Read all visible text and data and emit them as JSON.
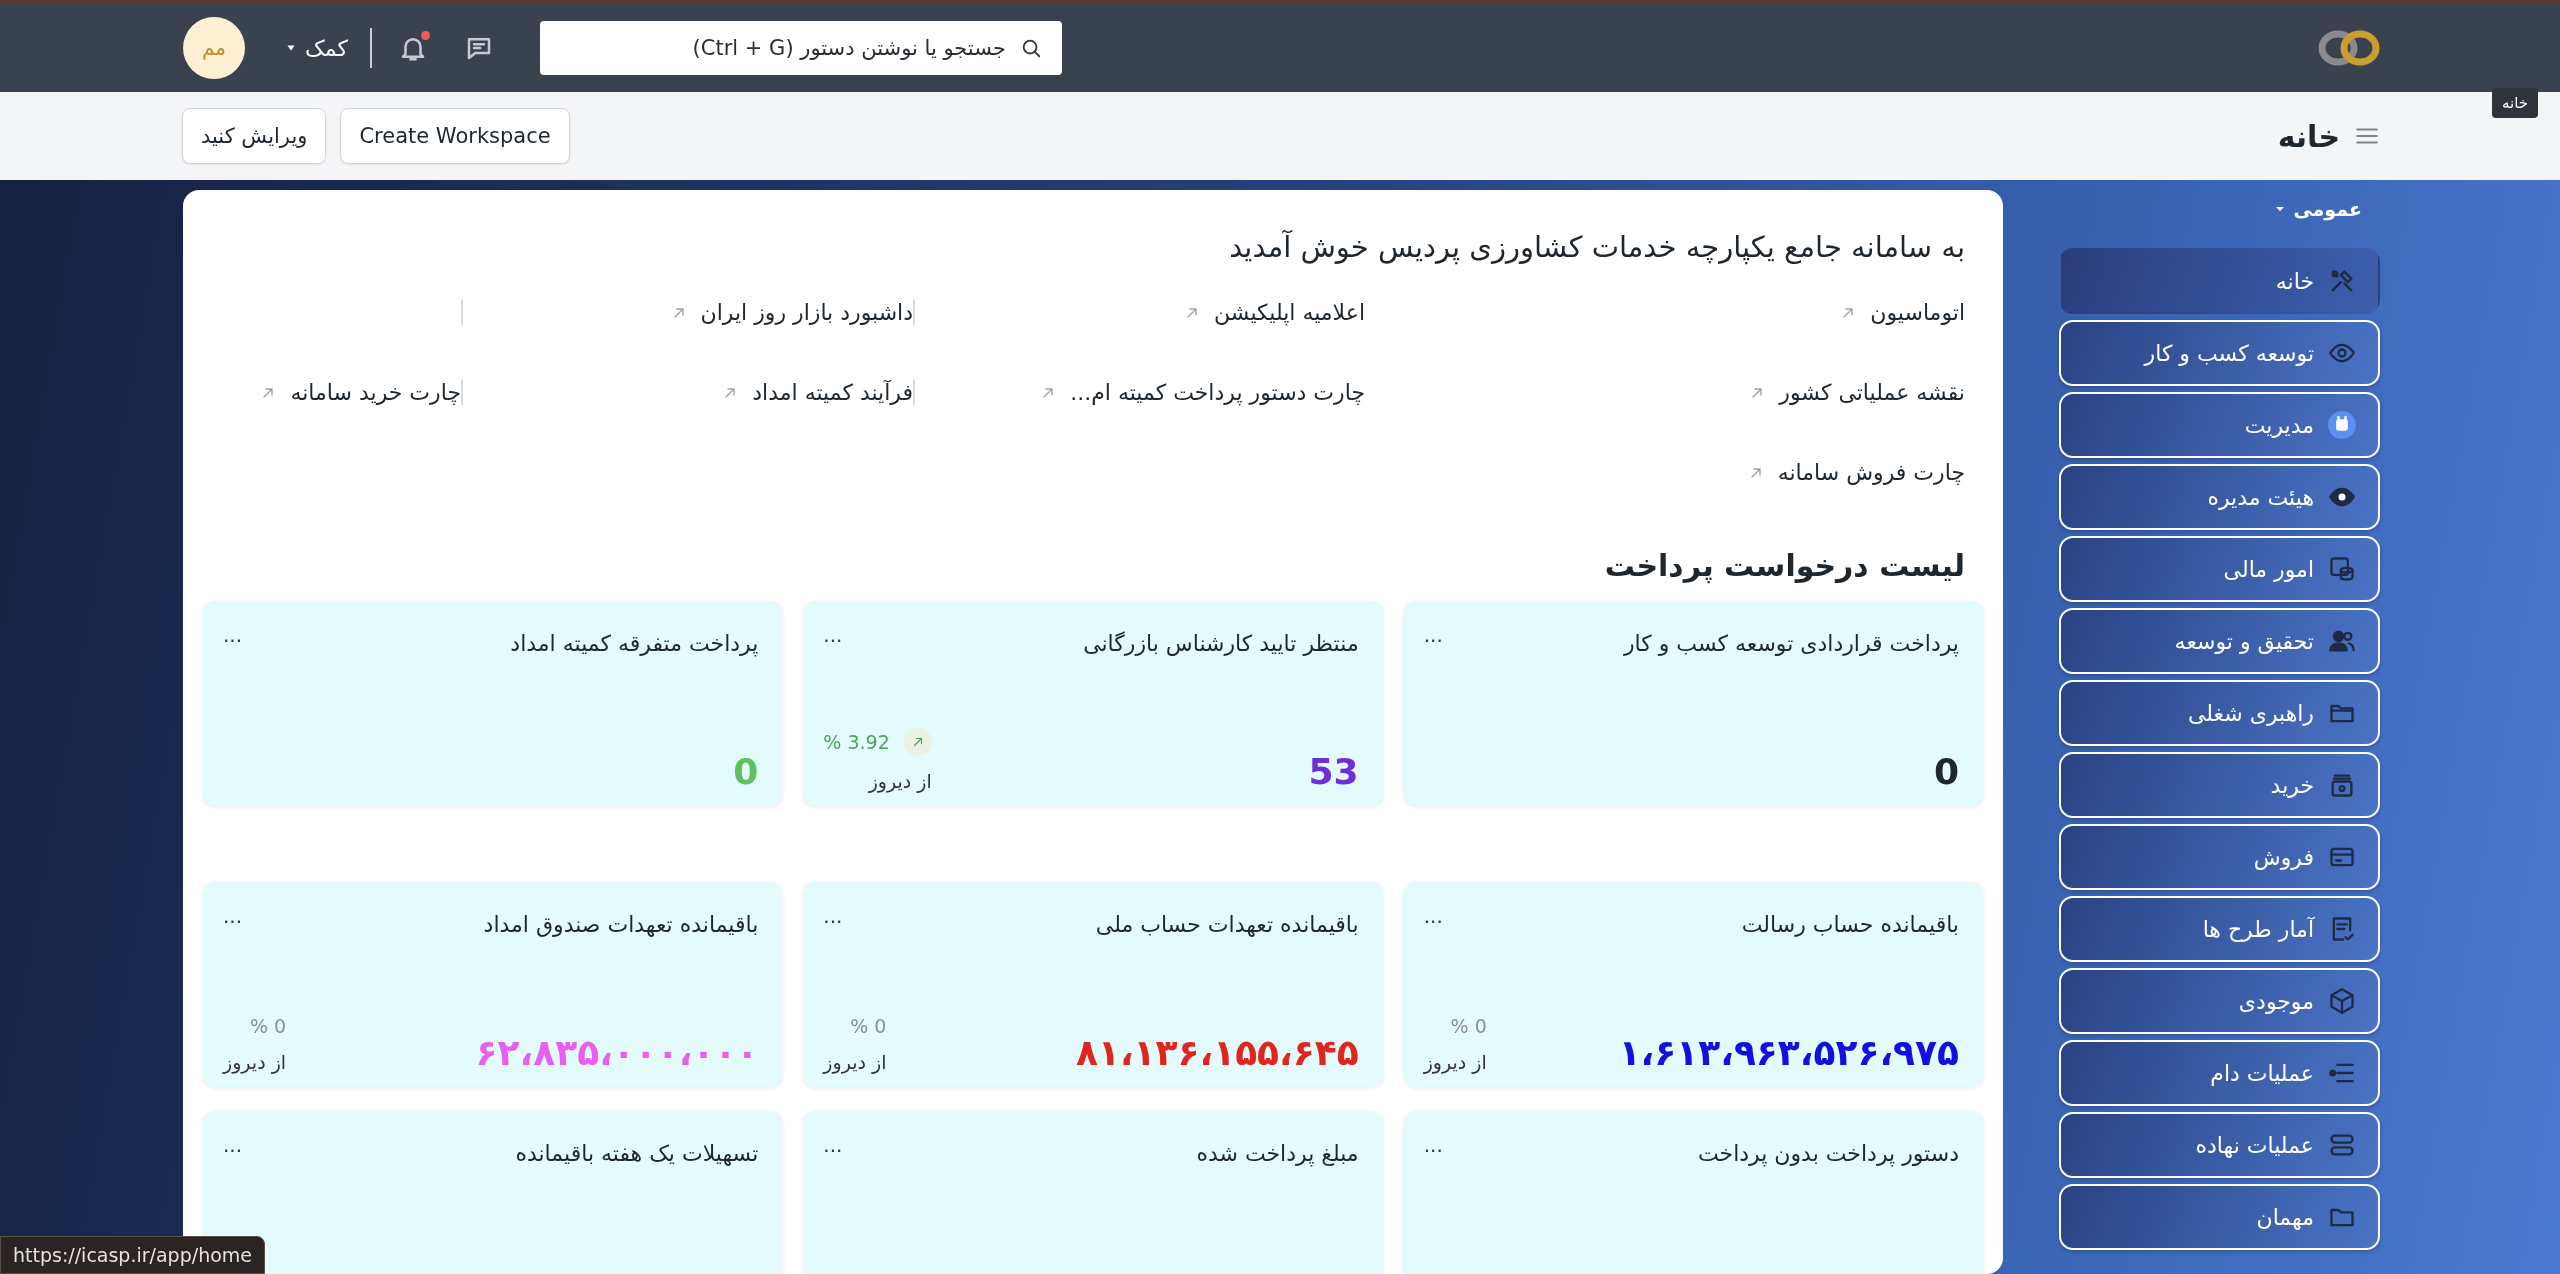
{
  "navbar": {
    "search": {
      "placeholder": "جستجو یا نوشتن دستور (Ctrl + G)"
    },
    "notifications": {
      "unread": true
    },
    "help": {
      "label": "کمک"
    },
    "avatar": {
      "initials": "مم"
    }
  },
  "tooltip": {
    "text": "خانه"
  },
  "page_header": {
    "title": "خانه",
    "buttons": [
      {
        "label": "Create Workspace"
      },
      {
        "label": "ویرایش کنید"
      }
    ]
  },
  "sidebar": {
    "section": {
      "label": "عمومی",
      "expanded": true
    },
    "items": [
      {
        "label": "خانه",
        "selected": true
      },
      {
        "label": "توسعه کسب و کار",
        "selected": false
      },
      {
        "label": "مدیریت",
        "selected": false
      },
      {
        "label": "هیئت مدیره",
        "selected": false
      },
      {
        "label": "امور مالی",
        "selected": false
      },
      {
        "label": "تحقیق و توسعه",
        "selected": false
      },
      {
        "label": "راهبری شغلی",
        "selected": false
      },
      {
        "label": "خرید",
        "selected": false
      },
      {
        "label": "فروش",
        "selected": false
      },
      {
        "label": "آمار طرح ها",
        "selected": false
      },
      {
        "label": "موجودی",
        "selected": false
      },
      {
        "label": "عملیات دام",
        "selected": false
      },
      {
        "label": "عملیات نهاده",
        "selected": false
      },
      {
        "label": "مهمان",
        "selected": false
      }
    ]
  },
  "welcome": {
    "title": "به سامانه جامع یکپارچه خدمات کشاورزی پردیس خوش آمدید",
    "shortcut_rows": [
      [
        "اتوماسیون",
        "اعلامیه اپلیکیشن",
        "داشبورد بازار روز ایران"
      ],
      [
        "نقشه عملیاتی کشور",
        "چارت دستور پرداخت کمیته ام...",
        "فرآیند کمیته امداد",
        "چارت خرید سامانه"
      ],
      [
        "چارت فروش سامانه"
      ]
    ]
  },
  "sections": [
    {
      "title": "لیست درخواست پرداخت",
      "cards": [
        {
          "title": "پرداخت قراردادی توسعه کسب و کار",
          "menu": "...",
          "value": "0",
          "color": "#1f272e"
        },
        {
          "title": "منتظر تایید کارشناس بازرگانی",
          "menu": "...",
          "value": "53",
          "color": "#6d2fd6",
          "change": "3.92 %",
          "rising": true,
          "since": "از دیروز"
        },
        {
          "title": "پرداخت متفرقه کمیته امداد",
          "menu": "...",
          "value": "0",
          "color": "#5cc35c"
        }
      ]
    },
    {
      "cards": [
        {
          "title": "باقیمانده حساب رسالت",
          "menu": "...",
          "value": "۱،۶۱۳،۹۶۳،۵۲۶،۹۷۵",
          "color": "#1010e0",
          "change": "0 %",
          "rising": false,
          "since": "از دیروز"
        },
        {
          "title": "باقیمانده تعهدات حساب ملی",
          "menu": "...",
          "value": "۸۱،۱۳۶،۱۵۵،۶۴۵",
          "color": "#e0241e",
          "change": "0 %",
          "rising": false,
          "since": "از دیروز"
        },
        {
          "title": "باقیمانده تعهدات صندوق امداد",
          "menu": "...",
          "value": "۶۲،۸۳۵،۰۰۰،۰۰۰",
          "color": "#e85ef2",
          "change": "0 %",
          "rising": false,
          "since": "از دیروز"
        },
        {
          "title": "دستور پرداخت بدون پرداخت",
          "menu": "..."
        },
        {
          "title": "مبلغ پرداخت شده",
          "menu": "..."
        },
        {
          "title": "تسهیلات یک هفته باقیمانده",
          "menu": "..."
        }
      ]
    }
  ],
  "status_link": {
    "url": "https://icasp.ir/app/home"
  }
}
